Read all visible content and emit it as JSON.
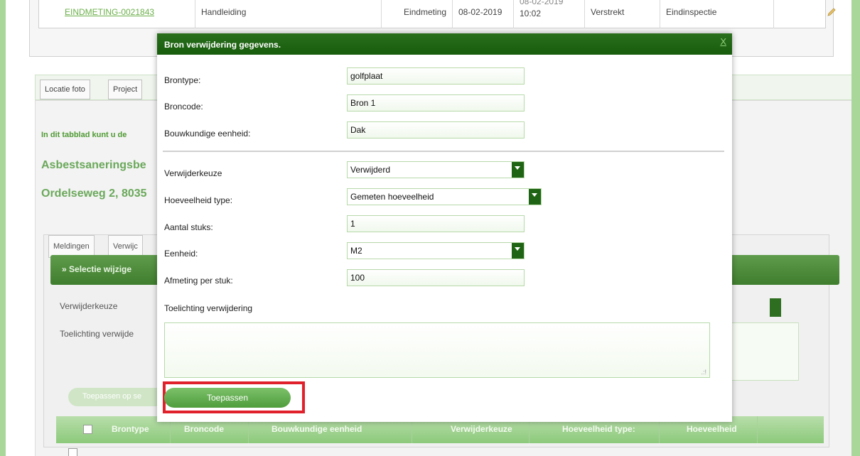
{
  "top_row": {
    "id": "EINDMETING-0021843",
    "type": "Handleiding",
    "kind": "Eindmeting",
    "date": "08-02-2019",
    "datetime_line1": "08-02-2019",
    "datetime_line2": "10:02",
    "status": "Verstrekt",
    "stage": "Eindinspectie"
  },
  "tabs": [
    "Locatie foto",
    "Project"
  ],
  "background": {
    "info_text": "In dit tabblad kunt u de",
    "heading1": "Asbestsaneringsbe",
    "heading2": "Ordelseweg 2, 8035",
    "subtabs": [
      "Meldingen",
      "Verwijc"
    ],
    "selection_bar": "Selectie wijzige",
    "label_verwijderkeuze": "Verwijderkeuze",
    "label_toelichting": "Toelichting verwijde",
    "apply_selected": "Toepassen op se"
  },
  "grid": {
    "headers": [
      "Brontype",
      "Broncode",
      "Bouwkundige eenheid",
      "Verwijderkeuze",
      "Hoeveelheid type:",
      "Hoeveelheid"
    ]
  },
  "modal": {
    "title": "Bron verwijdering gegevens.",
    "close": "X",
    "fields": {
      "brontype_label": "Brontype:",
      "brontype_value": "golfplaat",
      "broncode_label": "Broncode:",
      "broncode_value": "Bron 1",
      "bouwkundige_label": "Bouwkundige eenheid:",
      "bouwkundige_value": "Dak",
      "verwijderkeuze_label": "Verwijderkeuze",
      "verwijderkeuze_value": "Verwijderd",
      "hoeveelheid_type_label": "Hoeveelheid type:",
      "hoeveelheid_type_value": "Gemeten hoeveelheid",
      "aantal_label": "Aantal stuks:",
      "aantal_value": "1",
      "eenheid_label": "Eenheid:",
      "eenheid_value": "M2",
      "afmeting_label": "Afmeting per stuk:",
      "afmeting_value": "100",
      "toelichting_label": "Toelichting verwijdering"
    },
    "apply_button": "Toepassen"
  },
  "colors": {
    "accent_dark": "#1f6414",
    "accent_light": "#7cc16a",
    "highlight": "#e0212c"
  }
}
